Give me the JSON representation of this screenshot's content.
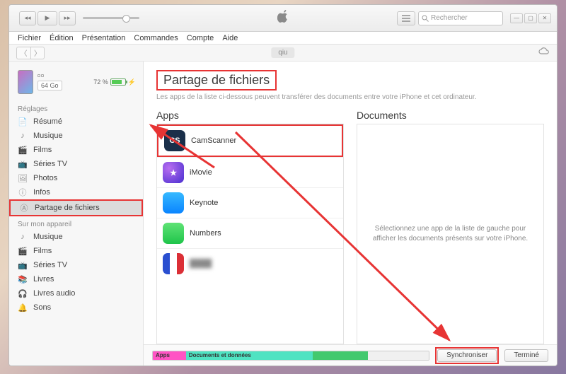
{
  "menubar": [
    "Fichier",
    "Édition",
    "Présentation",
    "Commandes",
    "Compte",
    "Aide"
  ],
  "search_placeholder": "Rechercher",
  "device": {
    "tab": "qiu",
    "capacity": "64 Go",
    "battery_pct": "72 %"
  },
  "sidebar": {
    "settings_head": "Réglages",
    "settings": [
      {
        "icon": "📄",
        "label": "Résumé"
      },
      {
        "icon": "♪",
        "label": "Musique"
      },
      {
        "icon": "🎬",
        "label": "Films"
      },
      {
        "icon": "📺",
        "label": "Séries TV"
      },
      {
        "icon": "🖼",
        "label": "Photos"
      },
      {
        "icon": "ⓘ",
        "label": "Infos"
      },
      {
        "icon": "Ⓐ",
        "label": "Partage de fichiers"
      }
    ],
    "device_head": "Sur mon appareil",
    "ondevice": [
      {
        "icon": "♪",
        "label": "Musique"
      },
      {
        "icon": "🎬",
        "label": "Films"
      },
      {
        "icon": "📺",
        "label": "Séries TV"
      },
      {
        "icon": "📚",
        "label": "Livres"
      },
      {
        "icon": "🎧",
        "label": "Livres audio"
      },
      {
        "icon": "🔔",
        "label": "Sons"
      }
    ]
  },
  "content": {
    "title": "Partage de fichiers",
    "subtitle": "Les apps de la liste ci-dessous peuvent transférer des documents entre votre iPhone et cet ordinateur.",
    "apps_head": "Apps",
    "docs_head": "Documents",
    "apps": [
      {
        "name": "CamScanner",
        "cls": "ic-cs",
        "txt": "CS"
      },
      {
        "name": "iMovie",
        "cls": "ic-im",
        "txt": "★"
      },
      {
        "name": "Keynote",
        "cls": "ic-kn",
        "txt": ""
      },
      {
        "name": "Numbers",
        "cls": "ic-nu",
        "txt": ""
      },
      {
        "name": "",
        "cls": "ic-fr",
        "txt": "",
        "blur": true
      }
    ],
    "docs_placeholder": "Sélectionnez une app de la liste de gauche pour afficher les documents présents sur votre iPhone."
  },
  "footer": {
    "seg_apps": "Apps",
    "seg_docs": "Documents et données",
    "sync": "Synchroniser",
    "done": "Terminé"
  }
}
